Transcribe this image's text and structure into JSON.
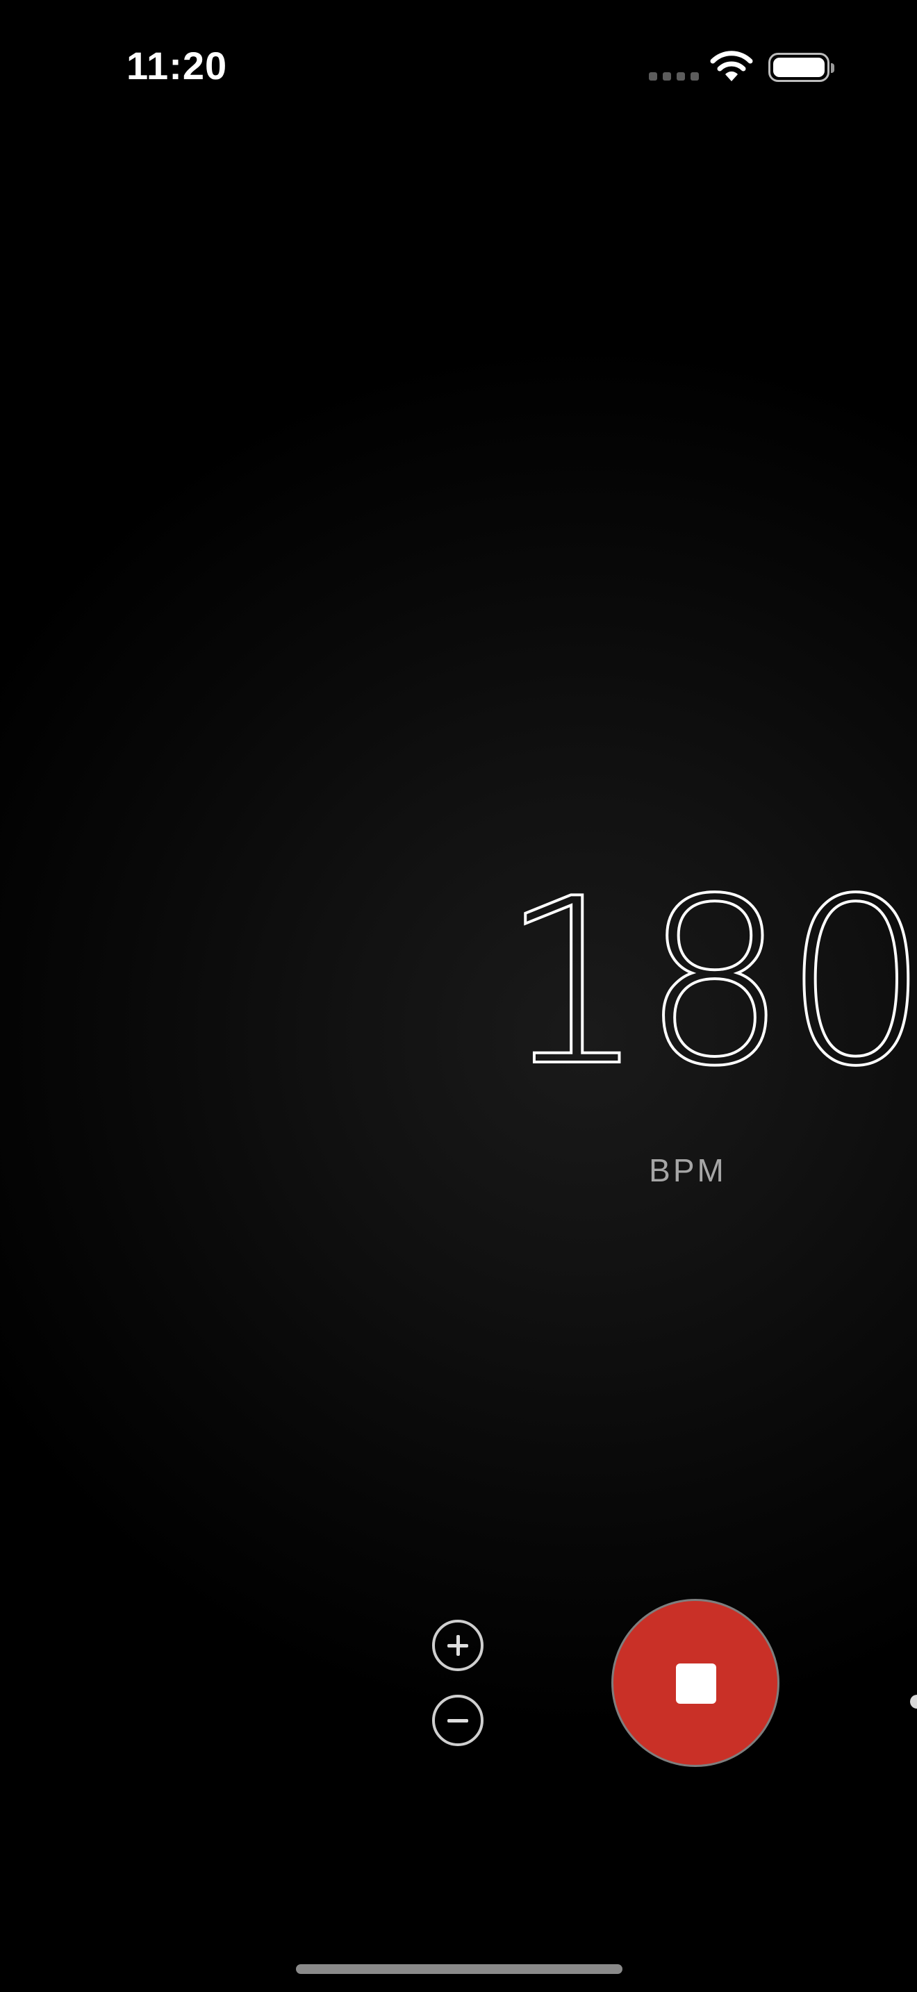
{
  "status_bar": {
    "time": "11:20",
    "wifi_icon": "wifi-icon",
    "battery_icon": "battery-icon",
    "signal_icon": "cellular-signal-icon"
  },
  "metronome": {
    "tempo": "180",
    "unit": "BPM"
  },
  "controls": {
    "increase_icon": "plus-circle-icon",
    "decrease_icon": "minus-circle-icon",
    "stop_icon": "stop-icon",
    "stop_button_color": "#c93027"
  }
}
